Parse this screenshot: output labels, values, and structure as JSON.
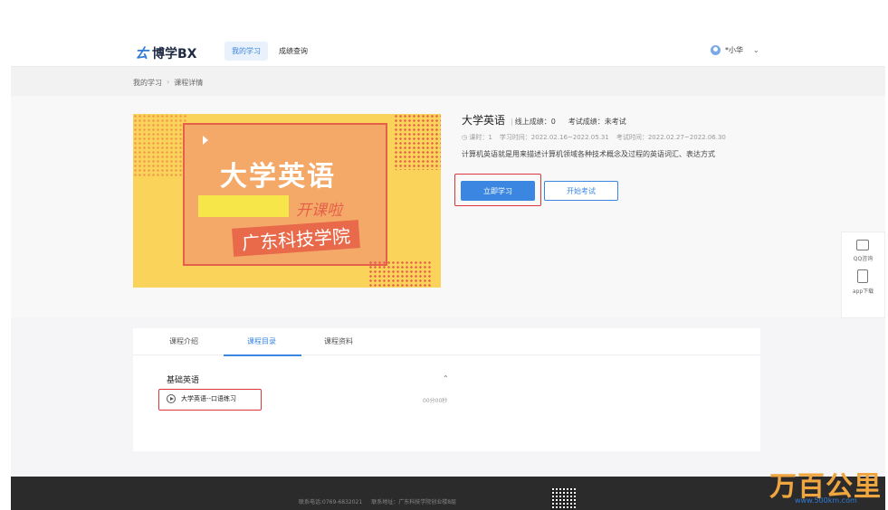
{
  "header": {
    "logo_mark": "ㄊ",
    "logo_text": "博学BX",
    "nav": [
      {
        "label": "我的学习",
        "active": true
      },
      {
        "label": "成绩查询",
        "active": false
      }
    ],
    "user_name": "*小华",
    "user_chevron": "⌄"
  },
  "breadcrumb": {
    "items": [
      "我的学习",
      "课程详情"
    ],
    "separator": "›"
  },
  "cover": {
    "title": "大学英语",
    "subtitle": "开课啦",
    "school": "广东科技学院"
  },
  "course": {
    "title": "大学英语",
    "online_score": "线上成绩：0",
    "exam_score": "考试成绩：未考试",
    "hours": "课时：1",
    "study_time": "学习时间：2022.02.16~2022.05.31",
    "exam_time": "考试时间：2022.02.27~2022.06.30",
    "description": "计算机英语就是用来描述计算机领域各种技术概念及过程的英语词汇、表达方式",
    "study_button": "立即学习",
    "exam_button": "开始考试",
    "clock_icon": "◷"
  },
  "float_panel": {
    "qq": "QQ咨询",
    "app": "app下载"
  },
  "tabs": [
    {
      "label": "课程介绍",
      "active": false
    },
    {
      "label": "课程目录",
      "active": true
    },
    {
      "label": "课程资料",
      "active": false
    }
  ],
  "catalog": {
    "section_title": "基础英语",
    "chevron": "⌃",
    "lesson_title": "大学英语--口语练习",
    "lesson_duration": "00分00秒"
  },
  "footer": {
    "phone": "联系电话:0769-6832021",
    "address": "联系地址：广东科技学院创业楼8层"
  },
  "watermark": {
    "main": "万百公里",
    "sub": "www.500km.com"
  },
  "colors": {
    "accent": "#3a86e0",
    "highlight_border": "#d9363e",
    "footer_bg": "#2b2b2b"
  }
}
